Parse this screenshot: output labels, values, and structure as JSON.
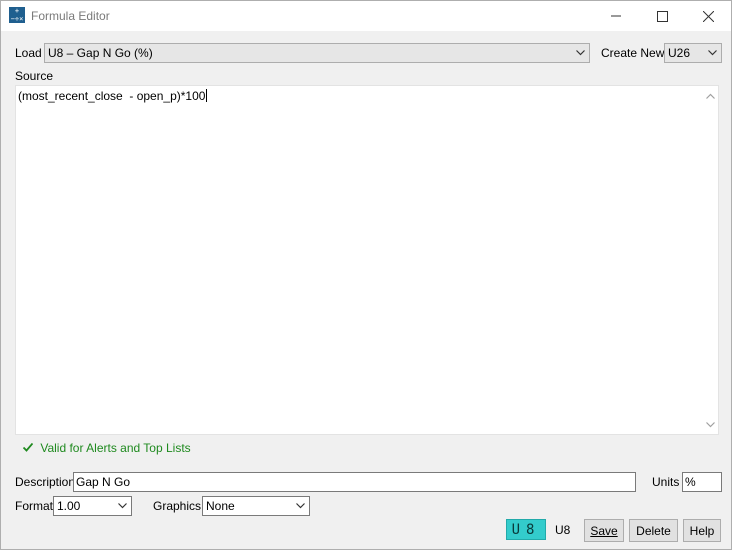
{
  "window": {
    "title": "Formula Editor",
    "app_icon_glyph": "+−÷×"
  },
  "load": {
    "label": "Load",
    "selected": "U8 – Gap N Go (%)"
  },
  "create_new": {
    "label": "Create New",
    "selected": "U26"
  },
  "source": {
    "label": "Source",
    "text": "(most_recent_close  - open_p)*100"
  },
  "validation": {
    "message": "Valid for Alerts and Top Lists",
    "color": "#1f8a1f"
  },
  "description": {
    "label": "Description",
    "value": "Gap N Go"
  },
  "units": {
    "label": "Units",
    "value": "%"
  },
  "format": {
    "label": "Format",
    "selected": "1.00"
  },
  "graphics": {
    "label": "Graphics",
    "selected": "None"
  },
  "footer": {
    "segment_display": "U8",
    "slot_label": "U8",
    "save_label": "Save",
    "delete_label": "Delete",
    "help_label": "Help",
    "segment_color": "#33cccc"
  },
  "icons": [
    "app-icon",
    "minimize-icon",
    "maximize-icon",
    "close-icon",
    "chevron-down-icon",
    "scroll-up-icon",
    "scroll-down-icon",
    "checkmark-icon"
  ]
}
